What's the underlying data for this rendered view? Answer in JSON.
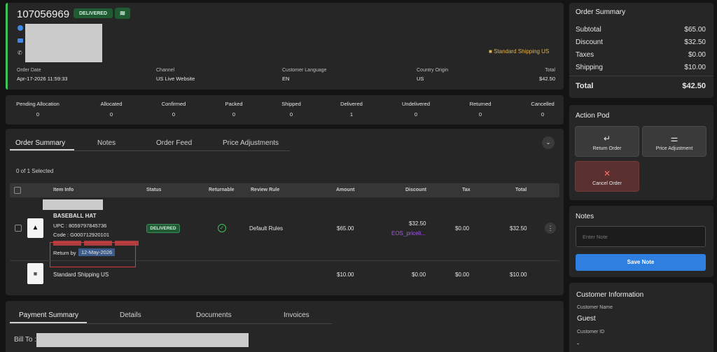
{
  "header": {
    "order_number": "107056969",
    "status_badge": "DELIVERED",
    "shipping_method": "Standard Shipping US",
    "fields": [
      {
        "label": "Order Date",
        "value": "Apr-17-2026 11:59:33"
      },
      {
        "label": "Channel",
        "value": "US Live Website"
      },
      {
        "label": "Customer Language",
        "value": "EN"
      },
      {
        "label": "Country Origin",
        "value": "US"
      },
      {
        "label": "Total",
        "value": "$42.50"
      }
    ]
  },
  "stats": [
    {
      "label": "Pending Allocation",
      "value": "0"
    },
    {
      "label": "Allocated",
      "value": "0"
    },
    {
      "label": "Confirmed",
      "value": "0"
    },
    {
      "label": "Packed",
      "value": "0"
    },
    {
      "label": "Shipped",
      "value": "0"
    },
    {
      "label": "Delivered",
      "value": "1"
    },
    {
      "label": "Undelivered",
      "value": "0"
    },
    {
      "label": "Returned",
      "value": "0"
    },
    {
      "label": "Cancelled",
      "value": "0"
    }
  ],
  "tabs": [
    "Order Summary",
    "Notes",
    "Order Feed",
    "Price Adjustments"
  ],
  "selection": "0 of 1 Selected",
  "table": {
    "headers": [
      "Item Info",
      "Status",
      "Returnable",
      "Review Rule",
      "Amount",
      "Discount",
      "Tax",
      "Total"
    ],
    "item": {
      "name": "BASEBALL HAT",
      "upc": "UPC : 8059797845736",
      "code": "Code : G000712920101",
      "status": "DELIVERED",
      "review_rule": "Default Rules",
      "amount": "$65.00",
      "discount": "$32.50",
      "discount_tag": "EOS_priceli...",
      "tax": "$0.00",
      "total": "$32.50",
      "return_by_label": "Return by",
      "return_by_date": "12-May-2026"
    },
    "shipping_row": {
      "name": "Standard Shipping US",
      "amount": "$10.00",
      "discount": "$0.00",
      "tax": "$0.00",
      "total": "$10.00"
    }
  },
  "bottom_tabs": [
    "Payment Summary",
    "Details",
    "Documents",
    "Invoices"
  ],
  "bill_to_label": "Bill To :",
  "order_summary": {
    "title": "Order Summary",
    "rows": [
      {
        "label": "Subtotal",
        "value": "$65.00"
      },
      {
        "label": "Discount",
        "value": "$32.50"
      },
      {
        "label": "Taxes",
        "value": "$0.00"
      },
      {
        "label": "Shipping",
        "value": "$10.00"
      }
    ],
    "total_label": "Total",
    "total_value": "$42.50"
  },
  "action_pod": {
    "title": "Action Pod",
    "return_order": "Return Order",
    "price_adjustment": "Price Adjustment",
    "cancel_order": "Cancel Order"
  },
  "notes": {
    "title": "Notes",
    "placeholder": "Enter Note",
    "save": "Save Note"
  },
  "customer": {
    "title": "Customer Information",
    "name_label": "Customer Name",
    "name_value": "Guest",
    "id_label": "Customer ID",
    "id_value": "-"
  },
  "colors": {
    "accent_blue": "#2e7fe0",
    "green": "#2e8b57",
    "cancel_red": "#5a2f2f",
    "purple": "#a35ce0"
  }
}
